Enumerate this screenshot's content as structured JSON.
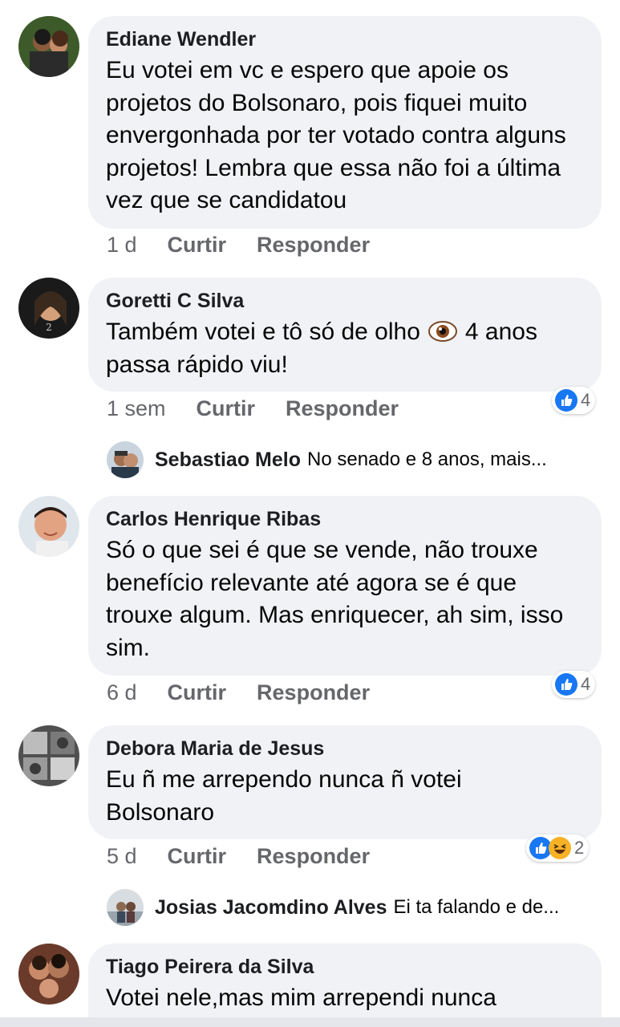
{
  "comments": [
    {
      "name": "Ediane Wendler",
      "text": "Eu votei em vc e espero que apoie os projetos do Bolsonaro, pois fiquei muito envergonhada por ter votado contra alguns projetos! Lembra que essa não foi a última vez que se candidatou",
      "time": "1 d",
      "like": "Curtir",
      "reply": "Responder"
    },
    {
      "name": "Goretti C Silva",
      "text_a": "Também votei e tô só de olho",
      "text_b": "4 anos passa rápido viu!",
      "emoji": "eye-emoji",
      "time": "1 sem",
      "like": "Curtir",
      "reply": "Responder",
      "reactions": {
        "count": "4",
        "icons": [
          "like-icon"
        ]
      }
    },
    {
      "name": "Carlos Henrique Ribas",
      "text": "Só o que sei é que se vende, não trouxe benefício relevante até agora se é que trouxe algum. Mas enriquecer, ah sim, isso sim.",
      "time": "6 d",
      "like": "Curtir",
      "reply": "Responder",
      "reactions": {
        "count": "4",
        "icons": [
          "like-icon"
        ]
      }
    },
    {
      "name": "Debora Maria de Jesus",
      "text": "Eu ñ me arrependo nunca ñ votei Bolsonaro",
      "time": "5 d",
      "like": "Curtir",
      "reply": "Responder",
      "reactions": {
        "count": "2",
        "icons": [
          "like-icon",
          "haha-icon"
        ]
      }
    },
    {
      "name": "Tiago Peirera da Silva",
      "text": "Votei nele,mas mim arrependi nunca"
    }
  ],
  "replies": [
    {
      "name": "Sebastiao Melo",
      "text": "No senado e 8 anos, mais..."
    },
    {
      "name": "Josias Jacomdino Alves",
      "text": "Ei ta falando e de..."
    }
  ],
  "colors": {
    "bubble": "#f0f2f5",
    "meta_text": "#65676b",
    "like_blue": "#1877f2",
    "haha_yellow": "#f7b125"
  }
}
